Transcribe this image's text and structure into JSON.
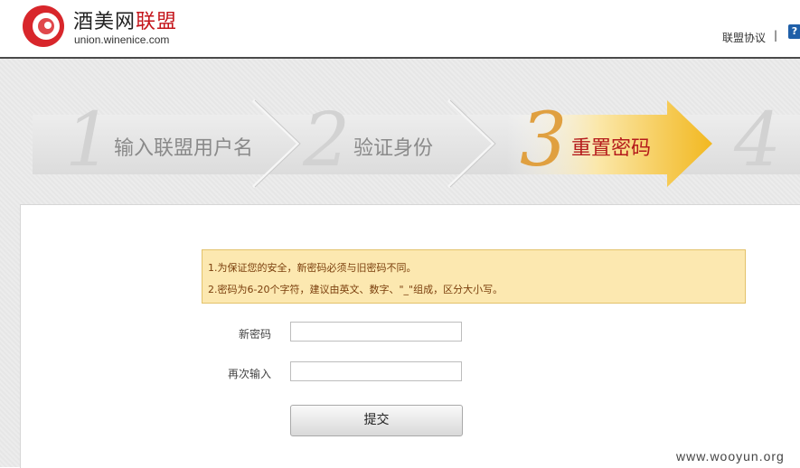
{
  "header": {
    "logo_cn_main": "酒美网",
    "logo_cn_accent": "联盟",
    "logo_url": "union.winenice.com",
    "link_agreement": "联盟协议",
    "separator": "|",
    "help_badge": "?"
  },
  "steps": [
    {
      "number": "1",
      "label": "输入联盟用户名",
      "active": false
    },
    {
      "number": "2",
      "label": "验证身份",
      "active": false
    },
    {
      "number": "3",
      "label": "重置密码",
      "active": true
    },
    {
      "number": "4",
      "label": "",
      "active": false
    }
  ],
  "notice": {
    "line1": "1.为保证您的安全，新密码必须与旧密码不同。",
    "line2": "2.密码为6-20个字符，建议由英文、数字、\"_\"组成，区分大小写。"
  },
  "form": {
    "new_password_label": "新密码",
    "new_password_value": "",
    "confirm_label": "再次输入",
    "confirm_value": "",
    "submit_label": "提交"
  },
  "watermark": "www.wooyun.org",
  "colors": {
    "brand_red": "#c4161c",
    "active_step_bg": "#f2b820",
    "notice_bg": "#fce8b0"
  }
}
